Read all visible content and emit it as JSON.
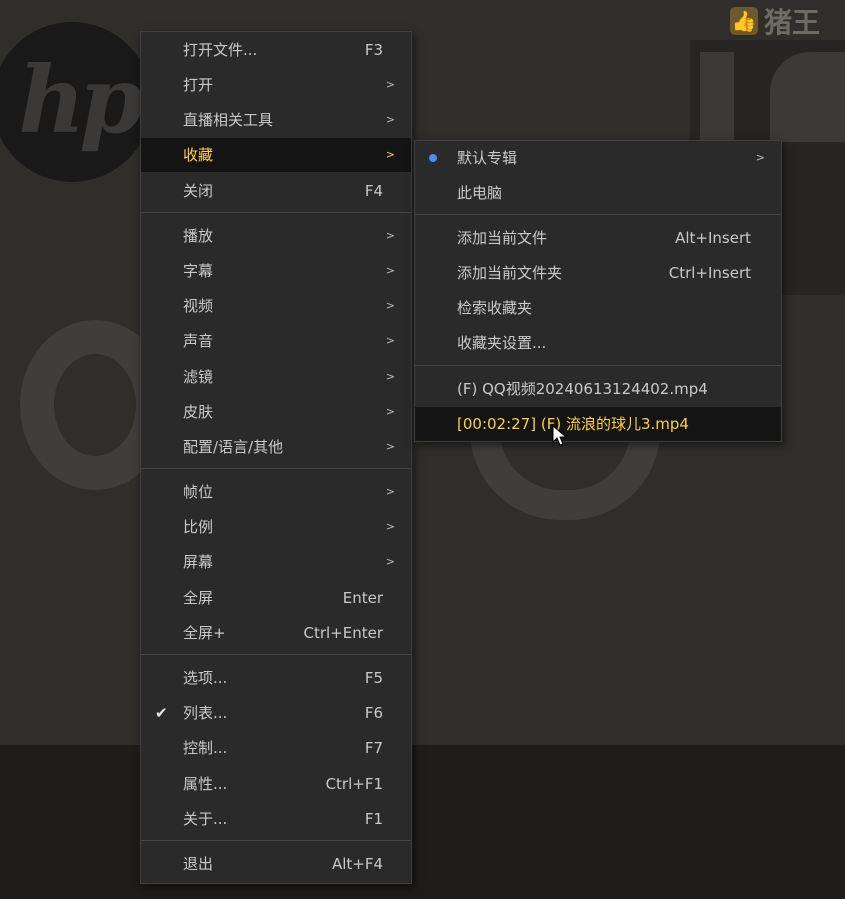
{
  "watermark": {
    "text": "猪王"
  },
  "background": {
    "logo_text": "hp"
  },
  "main_menu": {
    "items": [
      {
        "label": "打开文件...",
        "shortcut": "F3",
        "submenu": false
      },
      {
        "label": "打开",
        "shortcut": "",
        "submenu": true
      },
      {
        "label": "直播相关工具",
        "shortcut": "",
        "submenu": true
      },
      {
        "label": "收藏",
        "shortcut": "",
        "submenu": true,
        "active": true
      },
      {
        "label": "关闭",
        "shortcut": "F4",
        "submenu": false
      },
      {
        "label": "播放",
        "shortcut": "",
        "submenu": true
      },
      {
        "label": "字幕",
        "shortcut": "",
        "submenu": true
      },
      {
        "label": "视频",
        "shortcut": "",
        "submenu": true
      },
      {
        "label": "声音",
        "shortcut": "",
        "submenu": true
      },
      {
        "label": "滤镜",
        "shortcut": "",
        "submenu": true
      },
      {
        "label": "皮肤",
        "shortcut": "",
        "submenu": true
      },
      {
        "label": "配置/语言/其他",
        "shortcut": "",
        "submenu": true
      },
      {
        "label": "帧位",
        "shortcut": "",
        "submenu": true
      },
      {
        "label": "比例",
        "shortcut": "",
        "submenu": true
      },
      {
        "label": "屏幕",
        "shortcut": "",
        "submenu": true
      },
      {
        "label": "全屏",
        "shortcut": "Enter",
        "submenu": false
      },
      {
        "label": "全屏+",
        "shortcut": "Ctrl+Enter",
        "submenu": false
      },
      {
        "label": "选项...",
        "shortcut": "F5",
        "submenu": false
      },
      {
        "label": "列表...",
        "shortcut": "F6",
        "submenu": false,
        "checked": true
      },
      {
        "label": "控制...",
        "shortcut": "F7",
        "submenu": false
      },
      {
        "label": "属性...",
        "shortcut": "Ctrl+F1",
        "submenu": false
      },
      {
        "label": "关于...",
        "shortcut": "F1",
        "submenu": false
      },
      {
        "label": "退出",
        "shortcut": "Alt+F4",
        "submenu": false
      }
    ],
    "arrow_glyph": ">",
    "check_glyph": "✔"
  },
  "favorites_submenu": {
    "items": [
      {
        "label": "默认专辑",
        "shortcut": "",
        "submenu": true,
        "selected_dot": true
      },
      {
        "label": "此电脑",
        "shortcut": ""
      },
      {
        "label": "添加当前文件",
        "shortcut": "Alt+Insert"
      },
      {
        "label": "添加当前文件夹",
        "shortcut": "Ctrl+Insert"
      },
      {
        "label": "检索收藏夹",
        "shortcut": ""
      },
      {
        "label": "收藏夹设置...",
        "shortcut": ""
      },
      {
        "label": "(F) QQ视频20240613124402.mp4",
        "shortcut": ""
      },
      {
        "label": "[00:02:27] (F) 流浪的球儿3.mp4",
        "shortcut": "",
        "active": true
      }
    ]
  },
  "colors": {
    "menu_bg": "#2a2a2a",
    "active_bg": "#141414",
    "active_text": "#ffd23a",
    "text": "#c9c9c9",
    "dot": "#4a8df5"
  }
}
